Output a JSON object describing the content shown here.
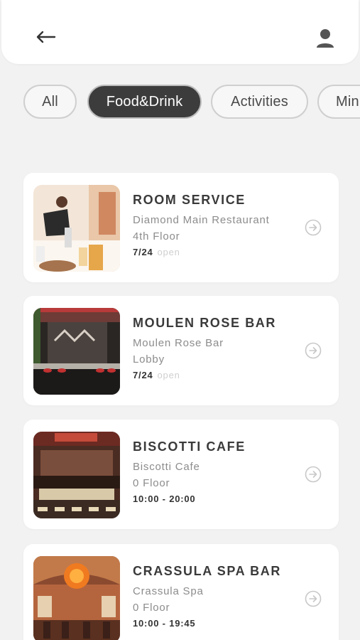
{
  "header": {
    "back_icon": "arrow-left-icon",
    "profile_icon": "user-icon"
  },
  "filters": [
    {
      "label": "All",
      "active": false
    },
    {
      "label": "Food&Drink",
      "active": true
    },
    {
      "label": "Activities",
      "active": false
    },
    {
      "label": "Min",
      "active": false
    }
  ],
  "venues": [
    {
      "name": "ROOM SERVICE",
      "place": "Diamond Main Restaurant",
      "floor": "4th Floor",
      "hours": "7/24",
      "status": "open"
    },
    {
      "name": "MOULEN ROSE BAR",
      "place": "Moulen Rose Bar",
      "floor": "Lobby",
      "hours": "7/24",
      "status": "open"
    },
    {
      "name": "BISCOTTI CAFE",
      "place": "Biscotti Cafe",
      "floor": "0 Floor",
      "hours": "10:00 - 20:00",
      "status": ""
    },
    {
      "name": "CRASSULA SPA BAR",
      "place": "Crassula Spa",
      "floor": "0 Floor",
      "hours": "10:00 - 19:45",
      "status": ""
    }
  ],
  "colors": {
    "background": "#f2f2f2",
    "active_chip": "#3c3c3c",
    "card": "#ffffff"
  }
}
